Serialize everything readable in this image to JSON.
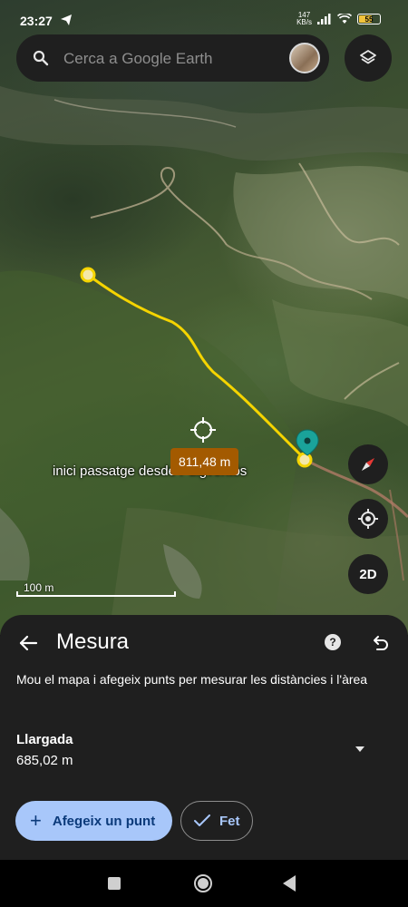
{
  "status_bar": {
    "time": "23:27",
    "network_speed_value": "147",
    "network_speed_unit": "KB/s",
    "battery_level": "55",
    "icons": [
      "telegram-icon",
      "signal-icon",
      "wifi-icon",
      "battery-icon"
    ]
  },
  "search": {
    "placeholder": "Cerca a Google Earth"
  },
  "map": {
    "distance_badge": "811,48 m",
    "place_label": "inici passatge desde Puigventós",
    "scale_label": "100 m",
    "route_color": "#f5d400",
    "marker_color": "#1aa39a",
    "controls": [
      "layers-icon",
      "compass-icon",
      "my-location-icon"
    ],
    "view_toggle": "2D"
  },
  "sheet": {
    "title": "Mesura",
    "help": "?",
    "description": "Mou el mapa i afegeix punts per mesurar les distàncies i l'àrea",
    "length_label": "Llargada",
    "length_value": "685,02 m",
    "add_point_label": "Afegeix un punt",
    "done_label": "Fet"
  },
  "colors": {
    "accent": "#a8c7fa",
    "sheet_background": "#1f1f1f",
    "badge": "#a35a00"
  }
}
